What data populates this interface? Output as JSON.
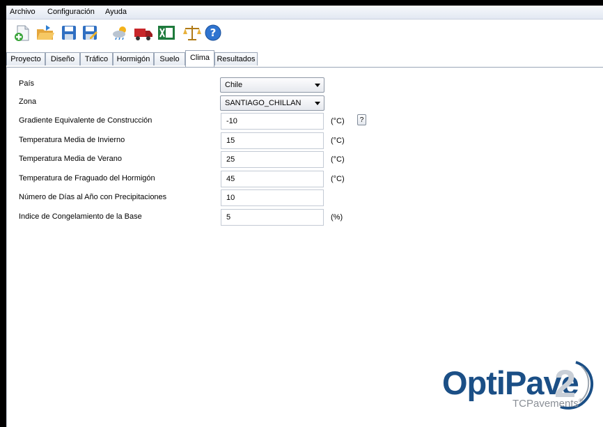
{
  "menu": [
    "Archivo",
    "Configuración",
    "Ayuda"
  ],
  "toolbar": {
    "icons": [
      "new-icon",
      "open-icon",
      "save-icon",
      "save-as-icon",
      "weather-icon",
      "truck-icon",
      "excel-icon",
      "scale-icon",
      "help-icon"
    ]
  },
  "tabs": [
    "Proyecto",
    "Diseño",
    "Tráfico",
    "Hormigón",
    "Suelo",
    "Clima",
    "Resultados"
  ],
  "active_tab": "Clima",
  "form": {
    "pais": {
      "label": "País",
      "value": "Chile"
    },
    "zona": {
      "label": "Zona",
      "value": "SANTIAGO_CHILLAN"
    },
    "gradiente": {
      "label": "Gradiente Equivalente de Construcción",
      "value": "-10",
      "unit": "(°C)",
      "help": "?"
    },
    "temp_invierno": {
      "label": "Temperatura Media de Invierno",
      "value": "15",
      "unit": "(°C)"
    },
    "temp_verano": {
      "label": "Temperatura Media de Verano",
      "value": "25",
      "unit": "(°C)"
    },
    "temp_fraguado": {
      "label": "Temperatura de Fraguado del Hormigón",
      "value": "45",
      "unit": "(°C)"
    },
    "dias_precip": {
      "label": "Número de Días al Año con Precipitaciones",
      "value": "10"
    },
    "congelamiento": {
      "label": "Indice de Congelamiento de la Base",
      "value": "5",
      "unit": "(%)"
    }
  },
  "logo": {
    "brand": "OptiPave",
    "version": "2",
    "company": "TCPavements",
    "trademark": "®"
  },
  "colors": {
    "logo_blue": "#1b4f86",
    "logo_gray": "#c9cfd7"
  }
}
